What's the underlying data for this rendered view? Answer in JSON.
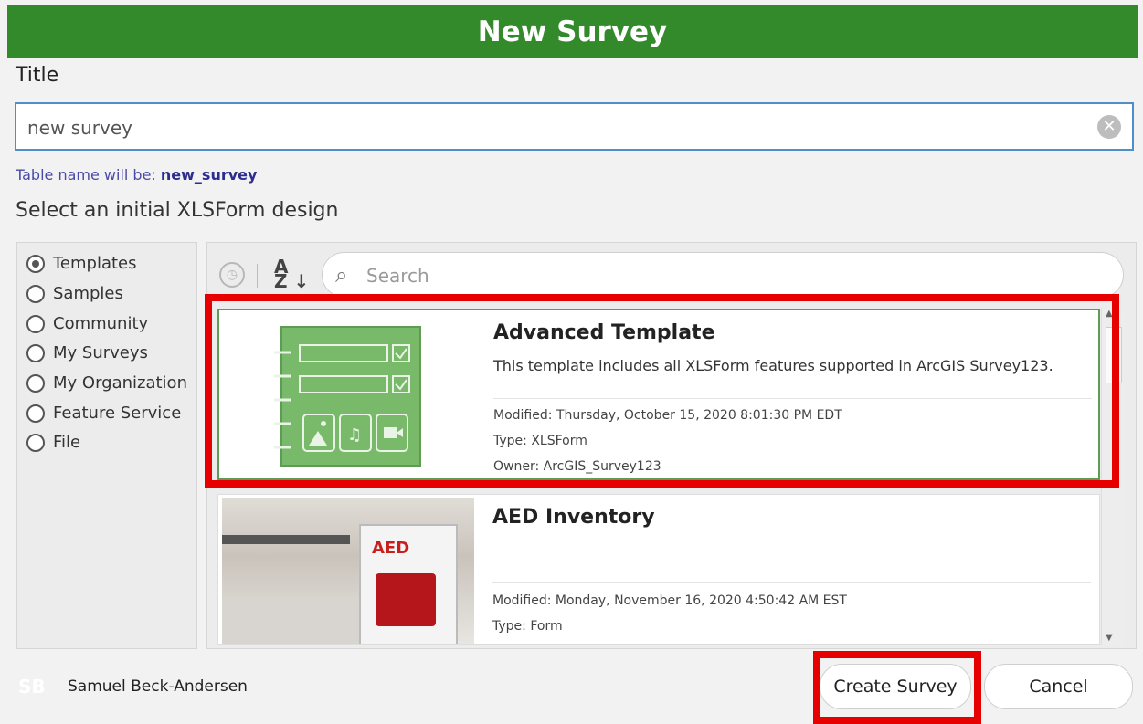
{
  "dialog": {
    "title": "New Survey"
  },
  "title_field": {
    "label": "Title",
    "value": "new survey"
  },
  "table_name": {
    "prefix": "Table name will be: ",
    "name": "new_survey"
  },
  "design_section": {
    "label": "Select an initial XLSForm design"
  },
  "sources": [
    {
      "label": "Templates",
      "checked": true
    },
    {
      "label": "Samples",
      "checked": false
    },
    {
      "label": "Community",
      "checked": false
    },
    {
      "label": "My Surveys",
      "checked": false
    },
    {
      "label": "My Organization",
      "checked": false
    },
    {
      "label": "Feature Service",
      "checked": false
    },
    {
      "label": "File",
      "checked": false
    }
  ],
  "search": {
    "placeholder": "Search"
  },
  "templates": [
    {
      "title": "Advanced Template",
      "description": "This template includes all XLSForm features supported in ArcGIS Survey123.",
      "modified": "Modified: Thursday, October 15, 2020 8:01:30 PM EDT",
      "type": "Type: XLSForm",
      "owner": "Owner: ArcGIS_Survey123"
    },
    {
      "title": "AED Inventory",
      "description": "",
      "modified": "Modified: Monday, November 16, 2020 4:50:42 AM EST",
      "type": "Type: Form",
      "image_text": "AED"
    }
  ],
  "footer": {
    "avatar_initials": "SB",
    "user_name": "Samuel Beck-Andersen",
    "create_label": "Create Survey",
    "cancel_label": "Cancel"
  },
  "colors": {
    "header": "#328a2a",
    "highlight": "#e60000",
    "selected_border": "#5e9b55"
  }
}
